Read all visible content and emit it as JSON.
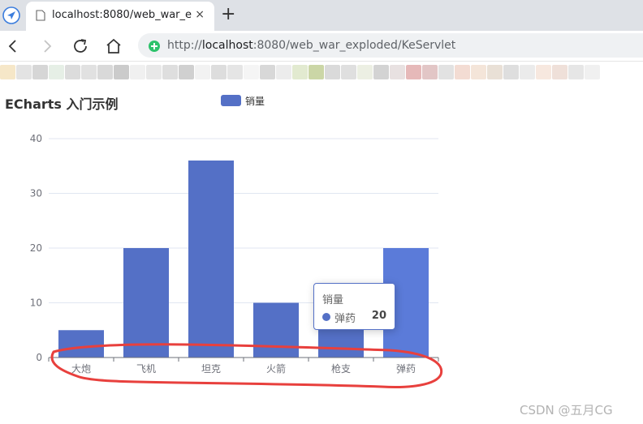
{
  "browser": {
    "tab_title": "localhost:8080/web_war_exploded/KeServlet",
    "close_glyph": "×",
    "newtab_glyph": "+",
    "url_prefix": "http://",
    "url_host": "localhost",
    "url_rest": ":8080/web_war_exploded/KeServlet"
  },
  "bookmark_colors": [
    "#f6e7c8",
    "#e3e3e3",
    "#d6d6d6",
    "#e6efe6",
    "#dcdcdc",
    "#e1e1e1",
    "#d9d9d9",
    "#cbcbcb",
    "#f0f0f0",
    "#e8e8e8",
    "#dedede",
    "#d0d0d0",
    "#f2f2f2",
    "#dddddd",
    "#e5e5e5",
    "#f5f5f5",
    "#d8d8d8",
    "#ececec",
    "#e2ead0",
    "#cbd6a6",
    "#dadada",
    "#dfdfdf",
    "#ecefe3",
    "#d3d3d3",
    "#e8e1e1",
    "#e6b9b9",
    "#e2c6c6",
    "#e2e2e2",
    "#f3dcd3",
    "#f4e5d9",
    "#e9e0d6",
    "#dedede",
    "#ebebeb",
    "#f7e8df",
    "#efe0d9",
    "#e6e6e6",
    "#f0f0f0"
  ],
  "chart_data": {
    "type": "bar",
    "title": "ECharts 入门示例",
    "legend": "销量",
    "categories": [
      "大炮",
      "飞机",
      "坦克",
      "火箭",
      "枪支",
      "弹药"
    ],
    "series": [
      {
        "name": "销量",
        "values": [
          5,
          20,
          36,
          10,
          10,
          20
        ]
      }
    ],
    "yticks": [
      0,
      10,
      20,
      30,
      40
    ],
    "ylim": [
      0,
      40
    ],
    "color": "#5470c6",
    "grid": true
  },
  "tooltip": {
    "series_name": "销量",
    "category": "弹药",
    "value": "20"
  },
  "annotation_color": "#e8403d",
  "watermark": "CSDN @五月CG"
}
